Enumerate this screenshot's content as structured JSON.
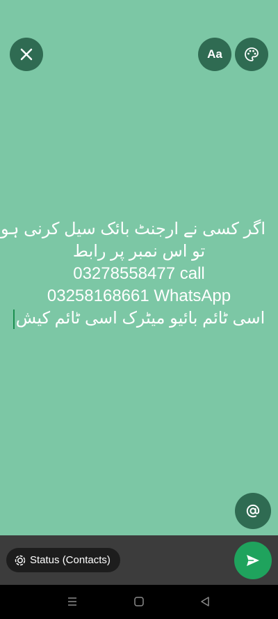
{
  "top_bar": {
    "close_icon": "close-icon",
    "font_label": "Aa",
    "palette_icon": "palette-icon"
  },
  "status": {
    "lines": [
      "اگر کسی نے ارجنٹ بائک سیل کرنی ہو",
      "تو اس نمبر پر رابط",
      "03278558477 call",
      "03258168661 WhatsApp",
      "اسی ٹائم بائیو میٹرک اسی ٹائم کیش"
    ]
  },
  "mention_icon": "at-icon",
  "audience": {
    "label": "Status (Contacts)",
    "icon": "status-icon"
  },
  "send_icon": "send-icon",
  "nav": {
    "menu_icon": "recents-icon",
    "home_icon": "home-icon",
    "back_icon": "back-icon"
  },
  "colors": {
    "background": "#7cc7a5",
    "button_bg": "#2f6b52",
    "send_bg": "#1fa35d",
    "bottom_bar": "#3c3c3c",
    "cursor": "#1b8f50"
  }
}
